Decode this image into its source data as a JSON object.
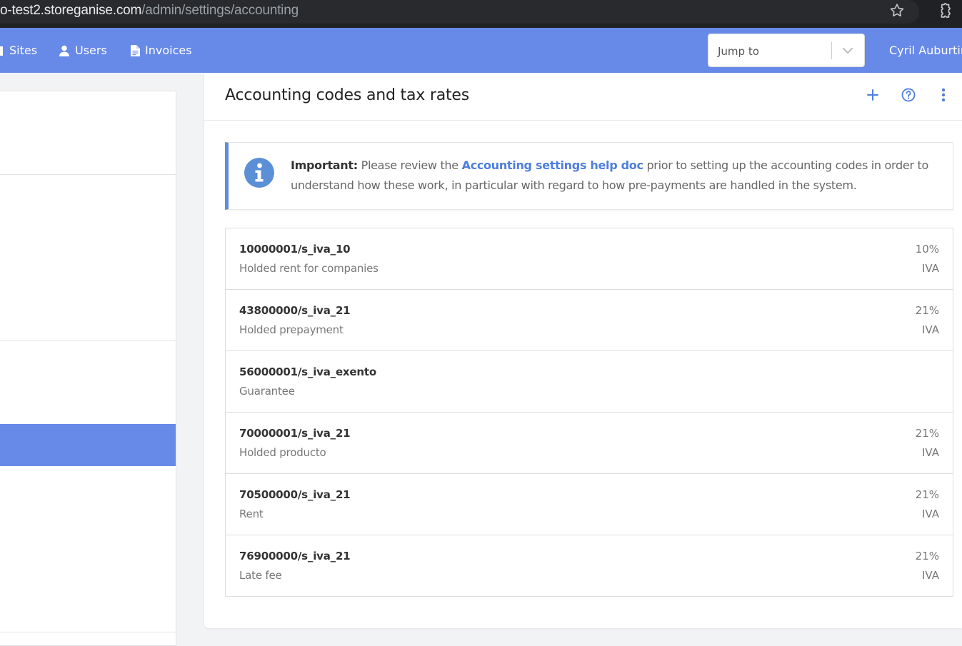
{
  "browser": {
    "url_host": "o-test2.storeganise.com",
    "url_path": "/admin/settings/accounting",
    "icons": [
      "star-icon",
      "extension-icon"
    ]
  },
  "nav": {
    "items": [
      {
        "label": "Sites",
        "icon": "sites-icon"
      },
      {
        "label": "Users",
        "icon": "user-icon"
      },
      {
        "label": "Invoices",
        "icon": "document-icon"
      }
    ],
    "jump_placeholder": "Jump to",
    "user_name": "Cyril Auburtin",
    "bar_color": "#6789e8"
  },
  "left_list": {
    "active_index": 8,
    "active_color": "#6789e8"
  },
  "panel": {
    "title": "Accounting codes and tax rates",
    "icons": [
      "plus-icon",
      "help-icon",
      "more-vertical-icon"
    ]
  },
  "notice": {
    "label": "Important:",
    "text_before": " Please review the ",
    "link": "Accounting settings help doc",
    "text_after": " prior to setting up the accounting codes in order to understand how these work, in particular with regard to how pre-payments are handled in the system.",
    "icon": "info-icon",
    "accent_color": "#5b8fd6"
  },
  "codes": [
    {
      "code": "10000001/s_iva_10",
      "description": "Holded rent for companies",
      "rate": "10%",
      "tax": "IVA"
    },
    {
      "code": "43800000/s_iva_21",
      "description": "Holded prepayment",
      "rate": "21%",
      "tax": "IVA"
    },
    {
      "code": "56000001/s_iva_exento",
      "description": "Guarantee",
      "rate": "",
      "tax": ""
    },
    {
      "code": "70000001/s_iva_21",
      "description": "Holded producto",
      "rate": "21%",
      "tax": "IVA"
    },
    {
      "code": "70500000/s_iva_21",
      "description": "Rent",
      "rate": "21%",
      "tax": "IVA"
    },
    {
      "code": "76900000/s_iva_21",
      "description": "Late fee",
      "rate": "21%",
      "tax": "IVA"
    }
  ]
}
